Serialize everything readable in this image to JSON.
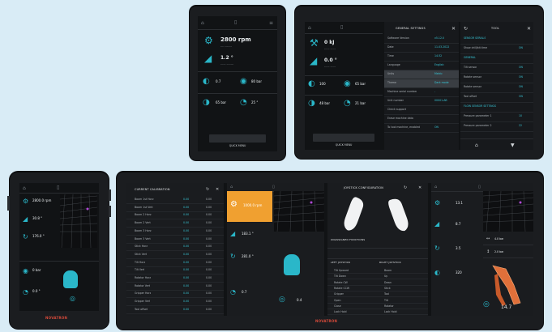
{
  "colors": {
    "accent": "#38c6d6",
    "orange": "#f0a030",
    "brand": "#d64a3a",
    "background": "#d9ecf6"
  },
  "dev1": {
    "rpm": "2800 rpm",
    "angle": "1.2 °",
    "v1": "0.7",
    "v2": "80 bar",
    "v3": "65 bar",
    "v4": "25 °",
    "button": "QUICK MENU"
  },
  "dev2": {
    "energy": "0 kJ",
    "angle": "0.0 °",
    "v1": "100",
    "v2": "65 bar",
    "v3": "48 bar",
    "v4": "21 bar",
    "button": "QUICK MENU",
    "settings_title": "GENERAL SETTINGS",
    "tool_title": "TOOL",
    "settings_rows": [
      {
        "label": "Software Version",
        "value": "v5.12.0"
      },
      {
        "label": "Date",
        "value": "11.03.2022"
      },
      {
        "label": "Time",
        "value": "14:32"
      },
      {
        "label": "Language",
        "value": "English"
      },
      {
        "label": "Units",
        "value": "Metric"
      },
      {
        "label": "Theme",
        "value": "Dark mode"
      },
      {
        "label": "Machine serial number",
        "value": "-"
      },
      {
        "label": "Unit number",
        "value": "00001-AB"
      },
      {
        "label": "Check support",
        "value": ""
      },
      {
        "label": "Erase machine data",
        "value": ""
      },
      {
        "label": "To tool machine, enabled",
        "value": "ON"
      }
    ],
    "tool_rows": [
      {
        "label": "SENSOR SERIALS",
        "value": ""
      },
      {
        "label": "Show drill/bit time",
        "value": "ON"
      },
      {
        "label": "GENERAL",
        "value": ""
      },
      {
        "label": "Tilt sensor",
        "value": "ON"
      },
      {
        "label": "Rotate sensor",
        "value": "ON"
      },
      {
        "label": "Rotate sensor",
        "value": "ON"
      },
      {
        "label": "Tool offset",
        "value": "ON"
      },
      {
        "label": "FLOW SENSOR SETTINGS",
        "value": ""
      },
      {
        "label": "Pressure parameter 1",
        "value": "10"
      },
      {
        "label": "Pressure parameter 2",
        "value": "22"
      }
    ]
  },
  "dev3": {
    "v1": "2800.0 rpm",
    "v2": "30.8 °",
    "v3": "176.0 °",
    "v4": "0 bar",
    "v5": "0.0 °",
    "logo": "NOVATRON"
  },
  "dev4": {
    "calib_title": "CURRENT CALIBRATION",
    "calib_rows": [
      {
        "label": "Boom 1st Horz",
        "a": "0.00",
        "b": "0.00"
      },
      {
        "label": "Boom 1st Vert",
        "a": "0.00",
        "b": "0.00"
      },
      {
        "label": "Boom 2 Horz",
        "a": "0.00",
        "b": "0.00"
      },
      {
        "label": "Boom 2 Vert",
        "a": "0.00",
        "b": "0.00"
      },
      {
        "label": "Boom 3 Horz",
        "a": "0.00",
        "b": "0.00"
      },
      {
        "label": "Boom 3 Vert",
        "a": "0.00",
        "b": "0.00"
      },
      {
        "label": "Stick Horz",
        "a": "0.00",
        "b": "0.00"
      },
      {
        "label": "Stick Vert",
        "a": "0.00",
        "b": "0.00"
      },
      {
        "label": "Tilt Horz",
        "a": "0.00",
        "b": "0.00"
      },
      {
        "label": "Tilt Vert",
        "a": "0.00",
        "b": "0.00"
      },
      {
        "label": "Rotator Horz",
        "a": "0.00",
        "b": "0.00"
      },
      {
        "label": "Rotator Vert",
        "a": "0.00",
        "b": "0.00"
      },
      {
        "label": "Gripper Horz",
        "a": "0.00",
        "b": "0.00"
      },
      {
        "label": "Gripper Vert",
        "a": "0.00",
        "b": "0.00"
      },
      {
        "label": "Tool offset",
        "a": "0.00",
        "b": "0.00"
      }
    ],
    "p2": {
      "v1": "1000.0 rpm",
      "v2": "183.1 °",
      "v3": "281.0 °",
      "v4": "0.7",
      "v5": "0.4"
    },
    "joystick_title": "JOYSTICK CONFIGURATION",
    "functions_title": "UNASSIGNED FUNCTIONS",
    "left_title": "LEFT JOYSTICK",
    "right_title": "RIGHT JOYSTICK",
    "left_rows": [
      "Tilt Upward",
      "Tilt Down",
      "Rotate CW",
      "Rotate CCW",
      "Gripper",
      "Open",
      "Close",
      "Lock Hold"
    ],
    "right_rows": [
      "Boom",
      "Up",
      "Down",
      "Stick",
      "Tool",
      "Tilt",
      "Rotator",
      "Lock Hold"
    ],
    "p4": {
      "v1": "13.1",
      "v2": "8.7",
      "v3": "3.5",
      "v4": "320",
      "v5": "14.7",
      "v6": "4.0 bar",
      "v7": "2.0 bar"
    },
    "logo": "NOVATRON"
  }
}
